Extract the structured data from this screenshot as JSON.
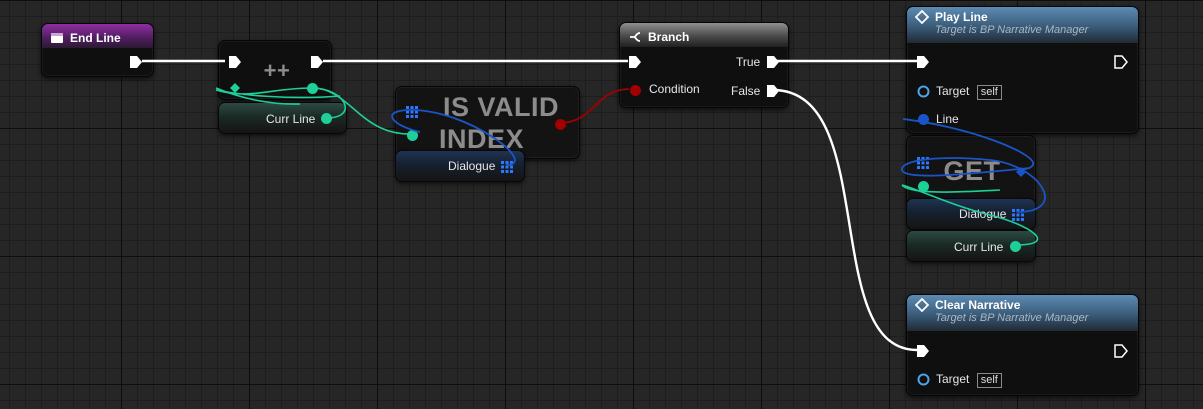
{
  "nodes": {
    "end_line": {
      "title": "End Line"
    },
    "increment": {
      "title": "++"
    },
    "curr_line_var": {
      "label": "Curr Line"
    },
    "is_valid_index": {
      "title_line1": "IS VALID",
      "title_line2": "INDEX"
    },
    "dialogue_var": {
      "label": "Dialogue"
    },
    "branch": {
      "title": "Branch",
      "condition_label": "Condition",
      "true_label": "True",
      "false_label": "False"
    },
    "play_line": {
      "title": "Play Line",
      "subtitle": "Target is BP Narrative Manager",
      "target_label": "Target",
      "target_value": "self",
      "line_label": "Line"
    },
    "get": {
      "title": "GET"
    },
    "get_dialogue_var": {
      "label": "Dialogue"
    },
    "get_curr_line_var": {
      "label": "Curr Line"
    },
    "clear_narrative": {
      "title": "Clear Narrative",
      "subtitle": "Target is BP Narrative Manager",
      "target_label": "Target",
      "target_value": "self"
    }
  },
  "colors": {
    "exec_wire": "#ffffff",
    "integer_pin": "#1ecf9a",
    "array_pin": "#1a55c8",
    "bool_pin": "#a00000",
    "object_pin": "#4fa3e6",
    "event_header": "#8e2fa2",
    "function_header": "#5d8bb4"
  },
  "icons": [
    "event-icon",
    "branch-icon",
    "function-icon",
    "array-grid-icon"
  ]
}
